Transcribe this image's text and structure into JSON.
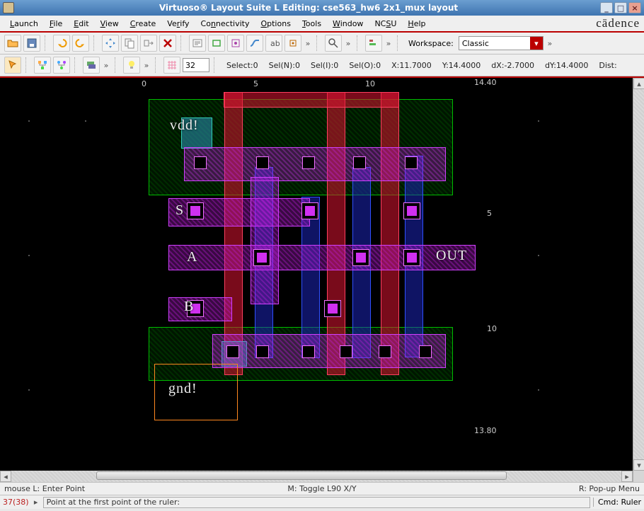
{
  "window": {
    "title": "Virtuoso® Layout Suite L Editing: cse563_hw6 2x1_mux layout"
  },
  "brand": "cādence",
  "menu": {
    "launch": "Launch",
    "file": "File",
    "edit": "Edit",
    "view": "View",
    "create": "Create",
    "verify": "Verify",
    "connectivity": "Connectivity",
    "options": "Options",
    "tools": "Tools",
    "window": "Window",
    "ncsu": "NCSU",
    "help": "Help"
  },
  "toolbar2": {
    "gridval": "32",
    "select": "Select:0",
    "seln": "Sel(N):0",
    "seli": "Sel(I):0",
    "selo": "Sel(O):0",
    "x": "X:11.7000",
    "y": "Y:14.4000",
    "dx": "dX:-2.7000",
    "dy": "dY:14.4000",
    "dist": "Dist:"
  },
  "workspace": {
    "label": "Workspace:",
    "value": "Classic"
  },
  "ruler_top": {
    "v0": "0",
    "v1": "5",
    "v2": "10",
    "vmax": "14.40"
  },
  "ruler_right": {
    "v1": "5",
    "v2": "10",
    "vmax": "13.80"
  },
  "pins": {
    "vdd": "vdd!",
    "gnd": "gnd!",
    "s": "S",
    "a": "A",
    "b": "B",
    "out": "OUT"
  },
  "status": {
    "mouseL": "mouse L: Enter Point",
    "mouseM": "M: Toggle L90 X/Y",
    "mouseR": "R: Pop-up Menu",
    "count": "37(38)",
    "prompt": "Point at the first point of the ruler:",
    "cmd": "Cmd: Ruler"
  }
}
